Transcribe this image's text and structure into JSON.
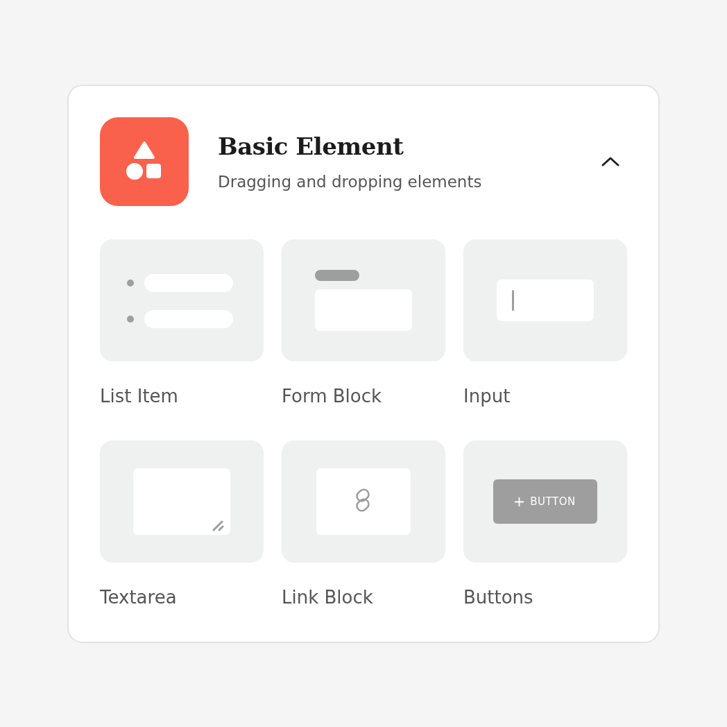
{
  "panel": {
    "title": "Basic Element",
    "subtitle": "Dragging and dropping elements",
    "expanded": true
  },
  "elements": [
    {
      "label": "List Item",
      "kind": "list"
    },
    {
      "label": "Form Block",
      "kind": "form"
    },
    {
      "label": "Input",
      "kind": "input"
    },
    {
      "label": "Textarea",
      "kind": "textarea"
    },
    {
      "label": "Link Block",
      "kind": "link"
    },
    {
      "label": "Buttons",
      "kind": "button",
      "preview_label": "BUTTON"
    }
  ]
}
